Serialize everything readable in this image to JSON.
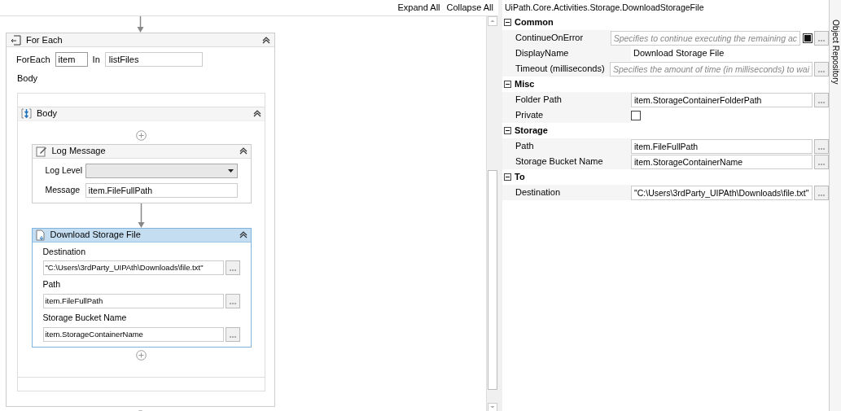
{
  "designer": {
    "toolbar": [
      "Expand All",
      "Collapse All"
    ],
    "for_each": {
      "title": "For Each",
      "foreach_label": "ForEach",
      "item": "item",
      "in_label": "In",
      "collection": "listFiles",
      "body_label": "Body",
      "sequence": {
        "title": "Body",
        "activities": [
          {
            "kind": "log_message",
            "title": "Log Message",
            "selected": false,
            "fields": [
              {
                "kind": "dropdown",
                "label": "Log Level"
              },
              {
                "kind": "text",
                "label": "Message",
                "value": "item.FileFullPath"
              }
            ]
          },
          {
            "kind": "download",
            "title": "Download Storage File",
            "selected": true,
            "fields": [
              {
                "label": "Destination",
                "value": "\"C:\\Users\\3rdParty_UIPAth\\Downloads\\file.txt\""
              },
              {
                "label": "Path",
                "value": "item.FileFullPath"
              },
              {
                "label": "Storage Bucket Name",
                "value": "item.StorageContainerName"
              }
            ]
          }
        ]
      }
    }
  },
  "properties": {
    "title": "UiPath.Core.Activities.Storage.DownloadStorageFile",
    "categories": [
      {
        "name": "Common",
        "rows": [
          {
            "kind": "toggle",
            "label": "ContinueOnError",
            "placeholder": "Specifies to continue executing the remaining ac"
          },
          {
            "kind": "plain",
            "label": "DisplayName",
            "value": "Download Storage File"
          },
          {
            "kind": "field",
            "label": "Timeout (milliseconds)",
            "placeholder": "Specifies the amount of time (in milliseconds) to wai"
          }
        ]
      },
      {
        "name": "Misc",
        "rows": [
          {
            "kind": "field",
            "label": "Folder Path",
            "value": "item.StorageContainerFolderPath"
          },
          {
            "kind": "checkbox",
            "label": "Private",
            "checked": false
          }
        ]
      },
      {
        "name": "Storage",
        "rows": [
          {
            "kind": "field",
            "label": "Path",
            "value": "item.FileFullPath"
          },
          {
            "kind": "field",
            "label": "Storage Bucket Name",
            "value": "item.StorageContainerName"
          }
        ]
      },
      {
        "name": "To",
        "rows": [
          {
            "kind": "field",
            "label": "Destination",
            "value": "\"C:\\Users\\3rdParty_UIPAth\\Downloads\\file.txt\""
          }
        ]
      }
    ]
  },
  "side_tabs": [
    "Object Repository"
  ]
}
